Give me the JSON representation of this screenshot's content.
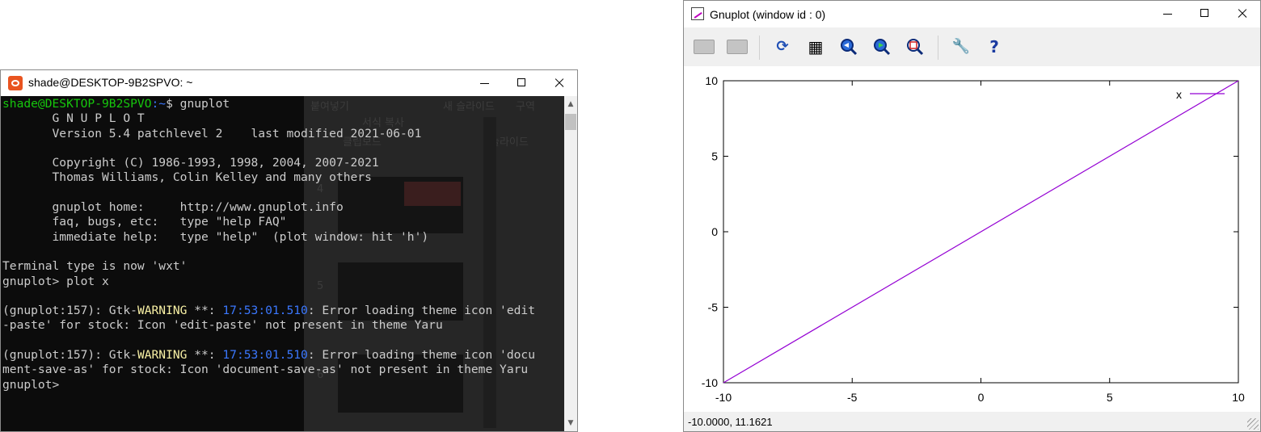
{
  "terminal": {
    "title": "shade@DESKTOP-9B2SPVO: ~",
    "prompt_user": "shade@DESKTOP-9B2SPVO",
    "prompt_path": ":~",
    "prompt_cmd": "$ gnuplot",
    "banner": [
      "       G N U P L O T",
      "       Version 5.4 patchlevel 2    last modified 2021-06-01",
      "",
      "       Copyright (C) 1986-1993, 1998, 2004, 2007-2021",
      "       Thomas Williams, Colin Kelley and many others",
      "",
      "       gnuplot home:     http://www.gnuplot.info",
      "       faq, bugs, etc:   type \"help FAQ\"",
      "       immediate help:   type \"help\"  (plot window: hit 'h')",
      "",
      "Terminal type is now 'wxt'",
      "gnuplot> plot x",
      ""
    ],
    "warnings": [
      {
        "prefix": "(gnuplot:157): Gtk-",
        "level": "WARNING",
        "stars": " **: ",
        "time": "17:53:01.510",
        "msg1": ": Error loading theme icon 'edit",
        "msg2": "-paste' for stock: Icon 'edit-paste' not present in theme Yaru"
      },
      {
        "prefix": "(gnuplot:157): Gtk-",
        "level": "WARNING",
        "stars": " **: ",
        "time": "17:53:01.510",
        "msg1": ": Error loading theme icon 'docu",
        "msg2": "ment-save-as' for stock: Icon 'document-save-as' not present in theme Yaru"
      }
    ],
    "final_prompt": "gnuplot>",
    "ghost_texts": [
      "붙여넣기",
      "새 슬라이드",
      "서식 복사",
      "클립보드",
      "슬라이드",
      "4",
      "5",
      "6",
      "구역"
    ]
  },
  "gnuplot": {
    "title": "Gnuplot (window id : 0)",
    "toolbar": [
      {
        "name": "copy-to-clipboard-icon",
        "enabled": false
      },
      {
        "name": "print-icon",
        "enabled": false
      },
      {
        "name": "replot-icon",
        "enabled": true
      },
      {
        "name": "grid-icon",
        "enabled": true
      },
      {
        "name": "previous-zoom-icon",
        "enabled": true
      },
      {
        "name": "next-zoom-icon",
        "enabled": true
      },
      {
        "name": "autoscale-icon",
        "enabled": true
      },
      {
        "name": "config-icon",
        "enabled": true
      },
      {
        "name": "help-icon",
        "enabled": true
      }
    ],
    "status": "-10.0000,  11.1621"
  },
  "chart_data": {
    "type": "line",
    "xlim": [
      -10,
      10
    ],
    "ylim": [
      -10,
      10
    ],
    "x_ticks": [
      -10,
      -5,
      0,
      5,
      10
    ],
    "y_ticks": [
      -10,
      -5,
      0,
      5,
      10
    ],
    "grid": false,
    "legend_position": "top-right",
    "series": [
      {
        "name": "x",
        "x": [
          -10,
          10
        ],
        "y": [
          -10,
          10
        ],
        "color": "#9400d3"
      }
    ]
  }
}
